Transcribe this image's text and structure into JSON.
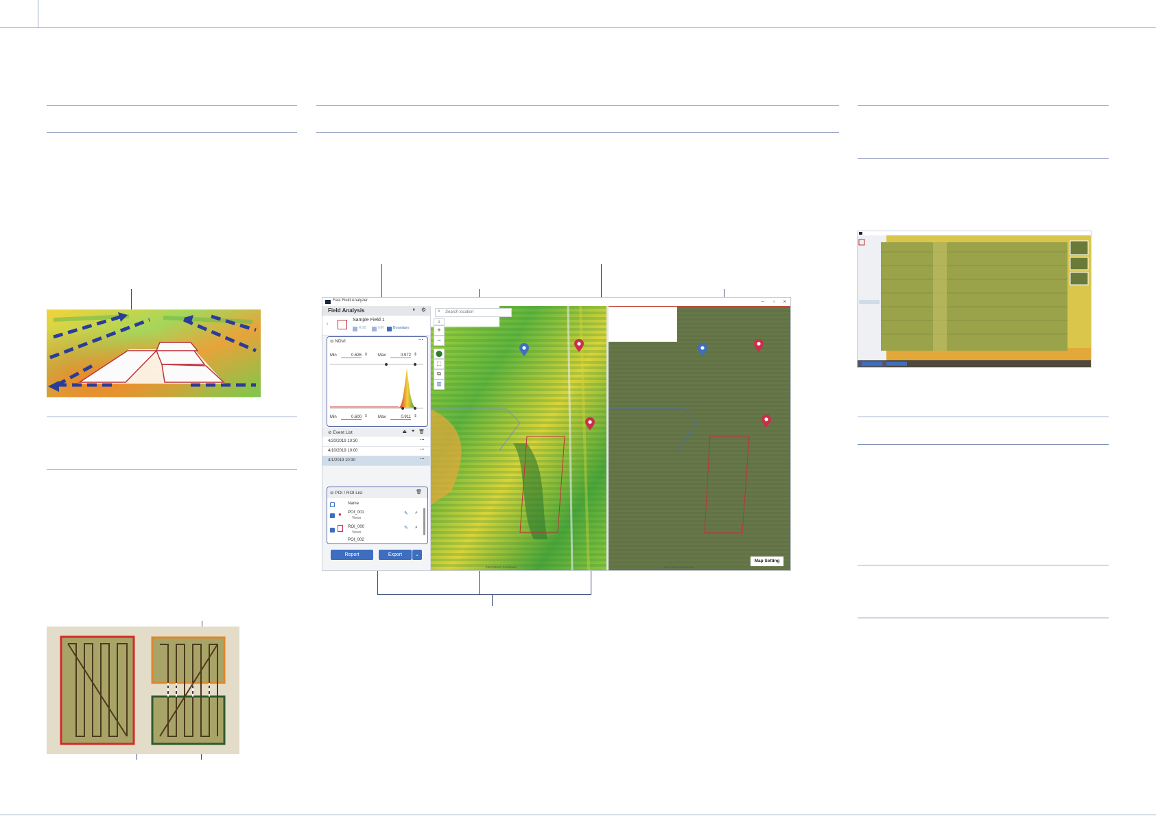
{
  "app": {
    "window_title": "Fast Field Analyzer",
    "panel_title": "Field Analysis",
    "field_name": "Sample Field 1",
    "toggle_1": "RGB",
    "toggle_2": "NIR",
    "toggle_boundary": "Boundary",
    "search_placeholder": "Search location",
    "index_section": {
      "title": "NDVI",
      "min_label": "Min",
      "max_label": "Max",
      "min_top": "0.626",
      "max_top": "0.972",
      "min_bottom": "0.600",
      "max_bottom": "0.911"
    },
    "event_list": {
      "title": "Event List",
      "items": [
        "4/20/2019 10:30",
        "4/10/2019 10:00",
        "4/1/2019 10:30"
      ]
    },
    "poi_list": {
      "title": "POI / ROI List",
      "column_name": "Name",
      "items": [
        {
          "name": "POI_001",
          "sub": "Views"
        },
        {
          "name": "ROI_000",
          "sub": "Views"
        },
        {
          "name": "POI_002",
          "sub": ""
        }
      ]
    },
    "report_button": "Report",
    "export_button": "Export",
    "map_setting_button": "Map Setting",
    "scale_left": "22nd Street Southeast",
    "scale_right": "22nd Street Southeast"
  },
  "colors": {
    "accent_blue": "#3d6ec0",
    "rule_blue": "#9aa9c9",
    "poi_red": "#c8304a",
    "poi_blue": "#3e6fb8",
    "roi_outline": "#c0303a"
  }
}
